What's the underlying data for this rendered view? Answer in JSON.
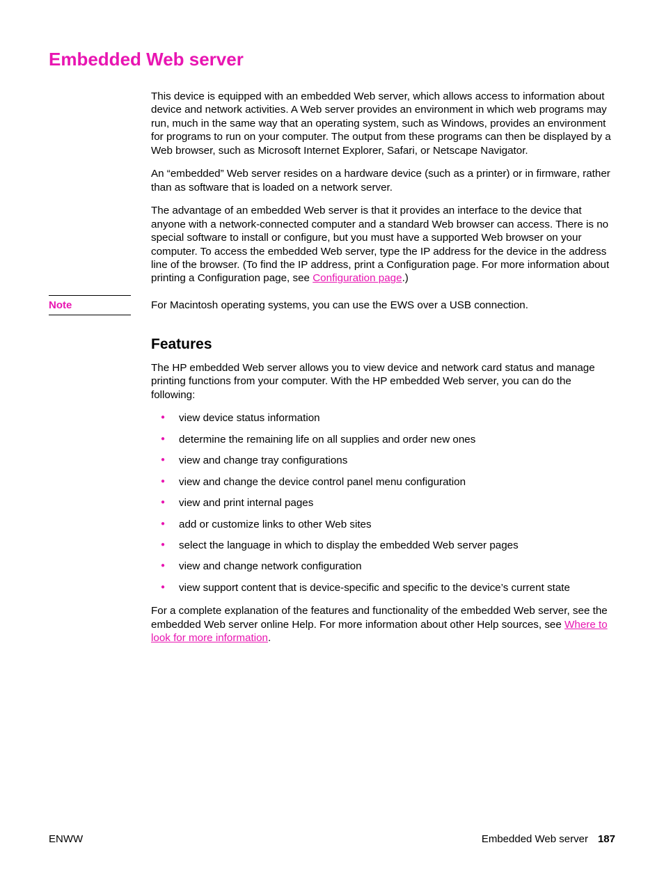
{
  "title": "Embedded Web server",
  "paragraphs": {
    "p1": "This device is equipped with an embedded Web server, which allows access to information about device and network activities. A Web server provides an environment in which web programs may run, much in the same way that an operating system, such as Windows, provides an environment for programs to run on your computer. The output from these programs can then be displayed by a Web browser, such as Microsoft Internet Explorer, Safari, or Netscape Navigator.",
    "p2": "An “embedded” Web server resides on a hardware device (such as a printer) or in firmware, rather than as software that is loaded on a network server.",
    "p3_pre": "The advantage of an embedded Web server is that it provides an interface to the device that anyone with a network-connected computer and a standard Web browser can access. There is no special software to install or configure, but you must have a supported Web browser on your computer. To access the embedded Web server, type the IP address for the device in the address line of the browser. (To find the IP address, print a Configuration page. For more information about printing a Configuration page, see ",
    "p3_link": "Configuration page",
    "p3_post": ".)",
    "note_label": "Note",
    "note_body": "For Macintosh operating systems, you can use the EWS over a USB connection.",
    "features_heading": "Features",
    "features_intro": "The HP embedded Web server allows you to view device and network card status and manage printing functions from your computer. With the HP embedded Web server, you can do the following:",
    "bullets": [
      "view device status information",
      "determine the remaining life on all supplies and order new ones",
      "view and change tray configurations",
      "view and change the device control panel menu configuration",
      "view and print internal pages",
      "add or customize links to other Web sites",
      "select the language in which to display the embedded Web server pages",
      "view and change network configuration",
      "view support content that is device-specific and specific to the device’s current state"
    ],
    "outro_pre": "For a complete explanation of the features and functionality of the embedded Web server, see the embedded Web server online Help. For more information about other Help sources, see ",
    "outro_link": "Where to look for more information",
    "outro_post": "."
  },
  "footer": {
    "left": "ENWW",
    "right": "Embedded Web server",
    "page": "187"
  }
}
